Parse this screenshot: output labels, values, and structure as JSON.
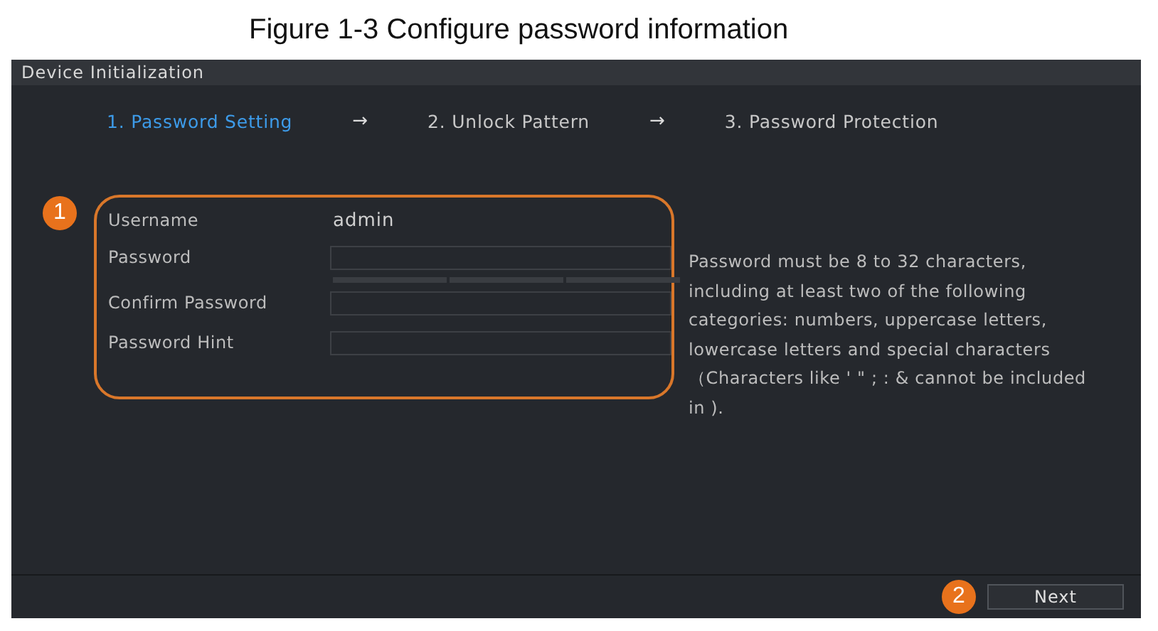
{
  "caption": "Figure 1-3 Configure password information",
  "window": {
    "title": "Device Initialization"
  },
  "steps": [
    {
      "label": "1.  Password Setting",
      "selected": true
    },
    {
      "label": "2.  Unlock Pattern",
      "selected": false
    },
    {
      "label": "3.  Password Protection",
      "selected": false
    }
  ],
  "step_separator": "→",
  "callouts": [
    "1",
    "2"
  ],
  "form": [
    {
      "kind": "text",
      "label": "Username",
      "value": "admin"
    },
    {
      "kind": "password",
      "label": "Password",
      "strength_meter": true
    },
    {
      "kind": "password",
      "label": "Confirm Password",
      "strength_meter": false
    },
    {
      "kind": "input",
      "label": "Password Hint"
    }
  ],
  "hint": "Password must be 8 to 32 characters, including at least two of the following categories: numbers, uppercase letters, lowercase letters and special characters （Characters like ' \" ; : & cannot be included in ).",
  "buttons": [
    "Next"
  ]
}
